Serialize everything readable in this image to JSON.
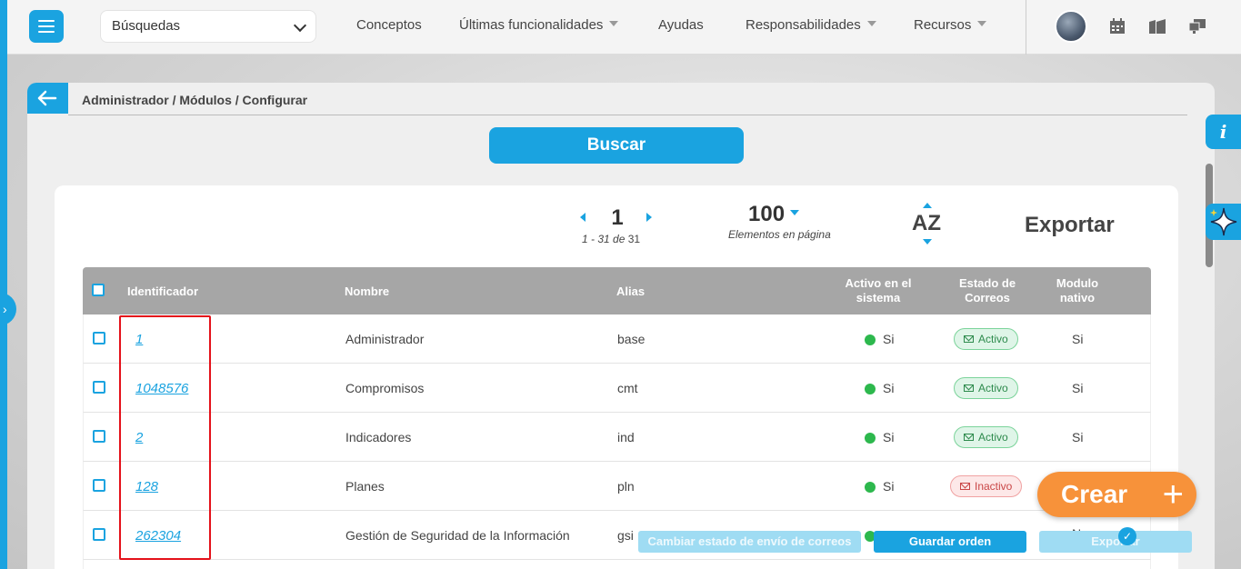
{
  "header": {
    "search_select_value": "Búsquedas",
    "nav": [
      {
        "label": "Conceptos",
        "has_caret": false
      },
      {
        "label": "Últimas funcionalidades",
        "has_caret": true
      },
      {
        "label": "Ayudas",
        "has_caret": false
      },
      {
        "label": "Responsabilidades",
        "has_caret": true
      },
      {
        "label": "Recursos",
        "has_caret": true
      }
    ],
    "icons": [
      "calendar-icon",
      "folders-icon",
      "monitor-icon"
    ]
  },
  "breadcrumb": "Administrador / Módulos / Configurar",
  "search_button": "Buscar",
  "pager": {
    "page": "1",
    "range": "1 - 31",
    "of_label": "de",
    "total": "31",
    "per_page": "100",
    "per_page_label": "Elementos en página",
    "sort_label": "AZ",
    "export_label": "Exportar"
  },
  "table": {
    "headers": {
      "id": "Identificador",
      "name": "Nombre",
      "alias": "Alias",
      "active": "Activo en el sistema",
      "mail_state": "Estado de Correos",
      "native": "Modulo nativo"
    },
    "rows": [
      {
        "id": "1",
        "name": "Administrador",
        "alias": "base",
        "active": "Si",
        "mail": "Activo",
        "mail_state": "active",
        "native": "Si"
      },
      {
        "id": "1048576",
        "name": "Compromisos",
        "alias": "cmt",
        "active": "Si",
        "mail": "Activo",
        "mail_state": "active",
        "native": "Si"
      },
      {
        "id": "2",
        "name": "Indicadores",
        "alias": "ind",
        "active": "Si",
        "mail": "Activo",
        "mail_state": "active",
        "native": "Si"
      },
      {
        "id": "128",
        "name": "Planes",
        "alias": "pln",
        "active": "Si",
        "mail": "Inactivo",
        "mail_state": "inactive",
        "native": ""
      },
      {
        "id": "262304",
        "name": "Gestión de Seguridad de la Información",
        "alias": "gsi",
        "active": "Si",
        "mail": "",
        "mail_state": "hidden",
        "native": "No"
      }
    ]
  },
  "actions": {
    "change_mail": "Cambiar estado de envío de correos",
    "save_order": "Guardar orden",
    "export": "Exportar",
    "create": "Crear"
  },
  "colors": {
    "accent": "#1aa3e0",
    "create": "#f7923a",
    "highlight": "#e4111a",
    "status_green": "#2db84d"
  }
}
